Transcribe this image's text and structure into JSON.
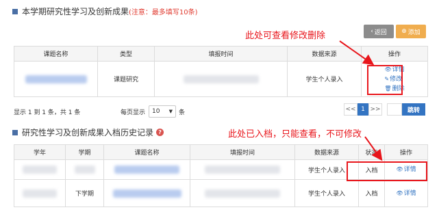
{
  "section1": {
    "title": "本学期研究性学习及创新成果",
    "warning": "(注意：最多填写10条)",
    "back_label": "返回",
    "add_label": "添加",
    "columns": [
      "课题名称",
      "类型",
      "填报时间",
      "数据来源",
      "操作"
    ],
    "row": {
      "type": "课题研究",
      "source": "学生个人录入"
    },
    "actions": {
      "detail": "详情",
      "edit": "修改",
      "delete": "删除"
    },
    "annotation": "此处可查看修改删除"
  },
  "pagination": {
    "summary": "显示 1 到 1 条，共 1 条",
    "per_page_label": "每页显示",
    "per_page_value": "10",
    "unit": "条",
    "prev": "<<",
    "page": "1",
    "next": ">>",
    "jump": "跳转"
  },
  "section2": {
    "title": "研究性学习及创新成果入档历史记录",
    "annotation": "此处已入档，只能查看，不可修改",
    "columns": [
      "学年",
      "学期",
      "课题名称",
      "填报时间",
      "数据来源",
      "状态",
      "操作"
    ],
    "rows": [
      {
        "term": "",
        "source": "学生个人录入",
        "status": "入档",
        "action": "详情"
      },
      {
        "term": "下学期",
        "source": "学生个人录入",
        "status": "入档",
        "action": "详情"
      }
    ]
  },
  "colors": {
    "annotation": "#e8151b",
    "link": "#3374c2",
    "add_button": "#f0ad4e",
    "back_button": "#8c8c8c"
  }
}
